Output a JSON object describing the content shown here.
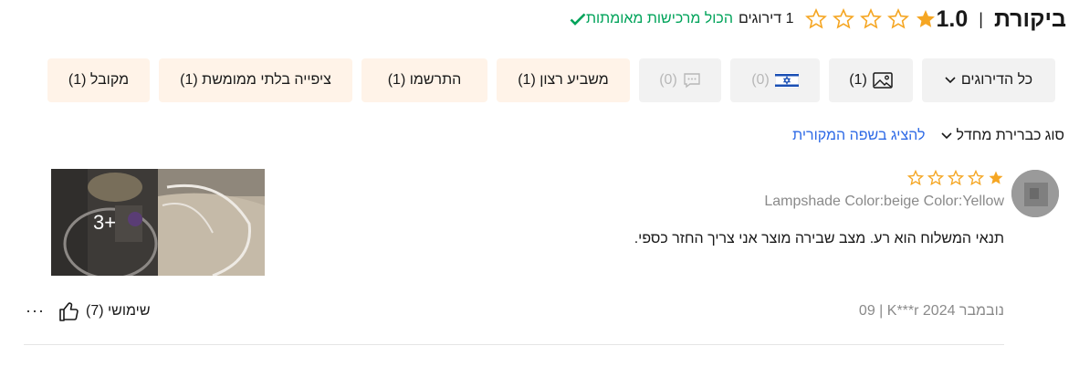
{
  "header": {
    "title": "ביקורת",
    "separator": "|",
    "score": "1.0",
    "rating_count": "1 דירוגים",
    "verified_text": "הכול מרכישות מאומתות",
    "star_color": "#f5a623",
    "verified_color": "#00a35a"
  },
  "filters": [
    {
      "label": "כל הדירוגים",
      "icon": "chevron-down-icon"
    },
    {
      "label": "(1)",
      "icon": "image-icon"
    },
    {
      "label": "(0)",
      "icon": "israel-flag-icon"
    },
    {
      "label": "(0)",
      "icon": "comment-icon"
    },
    {
      "label": "משביע רצון (1)"
    },
    {
      "label": "התרשמו (1)"
    },
    {
      "label": "ציפייה בלתי ממומשת (1)"
    },
    {
      "label": "מקובל (1)"
    }
  ],
  "sort": {
    "label": "סוג",
    "selected": "כברירת מחדל",
    "translate_link": "להציג בשפה המקורית"
  },
  "review": {
    "rating": 1,
    "attributes": "Lampshade Color:beige Color:Yellow",
    "text": "תנאי המשלוח הוא רע. מצב שבירה מוצר אני צריך החזר כספי.",
    "more_images": "3+",
    "date_author": "09 | K***r נובמבר 2024",
    "helpful_label": "שימושי (7)",
    "more_options": "···"
  }
}
